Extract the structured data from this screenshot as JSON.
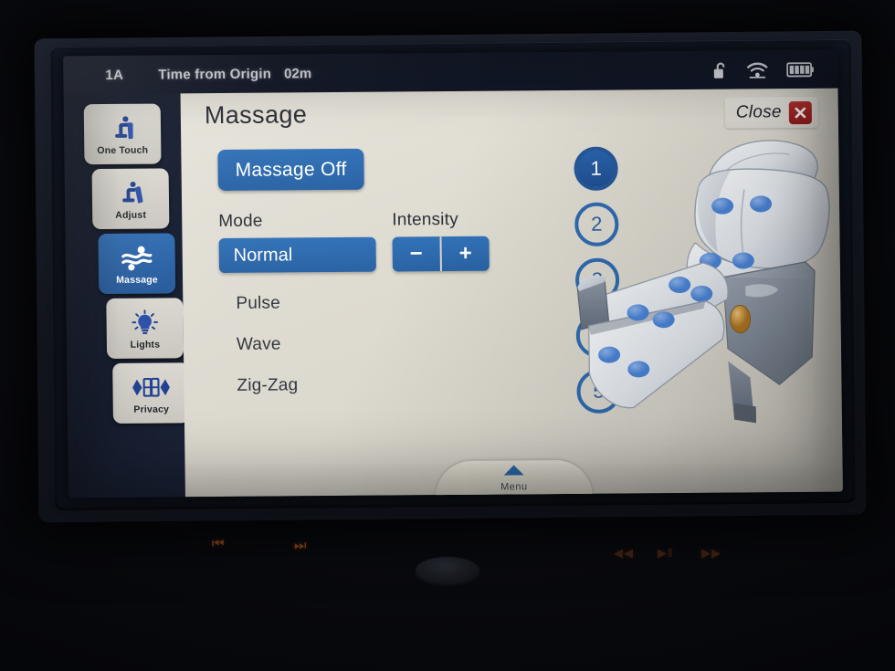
{
  "status_bar": {
    "seat": "1A",
    "time_label": "Time from Origin",
    "time_value": "02m",
    "icons": [
      "unlock-icon",
      "wifi-icon",
      "battery-icon"
    ]
  },
  "sidebar": {
    "items": [
      {
        "label": "One Touch",
        "icon": "seat-upright-icon",
        "active": false
      },
      {
        "label": "Adjust",
        "icon": "seat-recline-icon",
        "active": false
      },
      {
        "label": "Massage",
        "icon": "massage-waves-icon",
        "active": true
      },
      {
        "label": "Lights",
        "icon": "lightbulb-icon",
        "active": false
      },
      {
        "label": "Privacy",
        "icon": "privacy-divider-icon",
        "active": false
      }
    ]
  },
  "header": {
    "title": "Massage",
    "close_label": "Close",
    "close_icon": "close-x-icon"
  },
  "controls": {
    "power_button": "Massage Off",
    "mode_label": "Mode",
    "mode_selected": "Normal",
    "mode_options": [
      "Normal",
      "Pulse",
      "Wave",
      "Zig-Zag"
    ],
    "intensity_label": "Intensity",
    "intensity_minus": "−",
    "intensity_plus": "+"
  },
  "levels": {
    "values": [
      "1",
      "2",
      "3",
      "4",
      "5"
    ],
    "selected": "1"
  },
  "seat_diagram": {
    "name": "reclined-seat-massage-points",
    "massage_point_count": 12
  },
  "footer": {
    "menu_label": "Menu",
    "menu_icon": "triangle-up-icon"
  },
  "hardware_buttons": [
    {
      "name": "previous-track-button",
      "glyph": "⏮"
    },
    {
      "name": "next-track-button",
      "glyph": "⏭"
    },
    {
      "name": "rewind-button",
      "glyph": "◀◀"
    },
    {
      "name": "play-pause-button",
      "glyph": "▶‖"
    },
    {
      "name": "fast-forward-button",
      "glyph": "▶▶"
    }
  ],
  "colors": {
    "accent_blue": "#2f6cb2",
    "screen_bg": "#ded9cf",
    "rail_bg": "#141b2d",
    "close_red": "#b8312f",
    "status_bar": "#141a29"
  }
}
